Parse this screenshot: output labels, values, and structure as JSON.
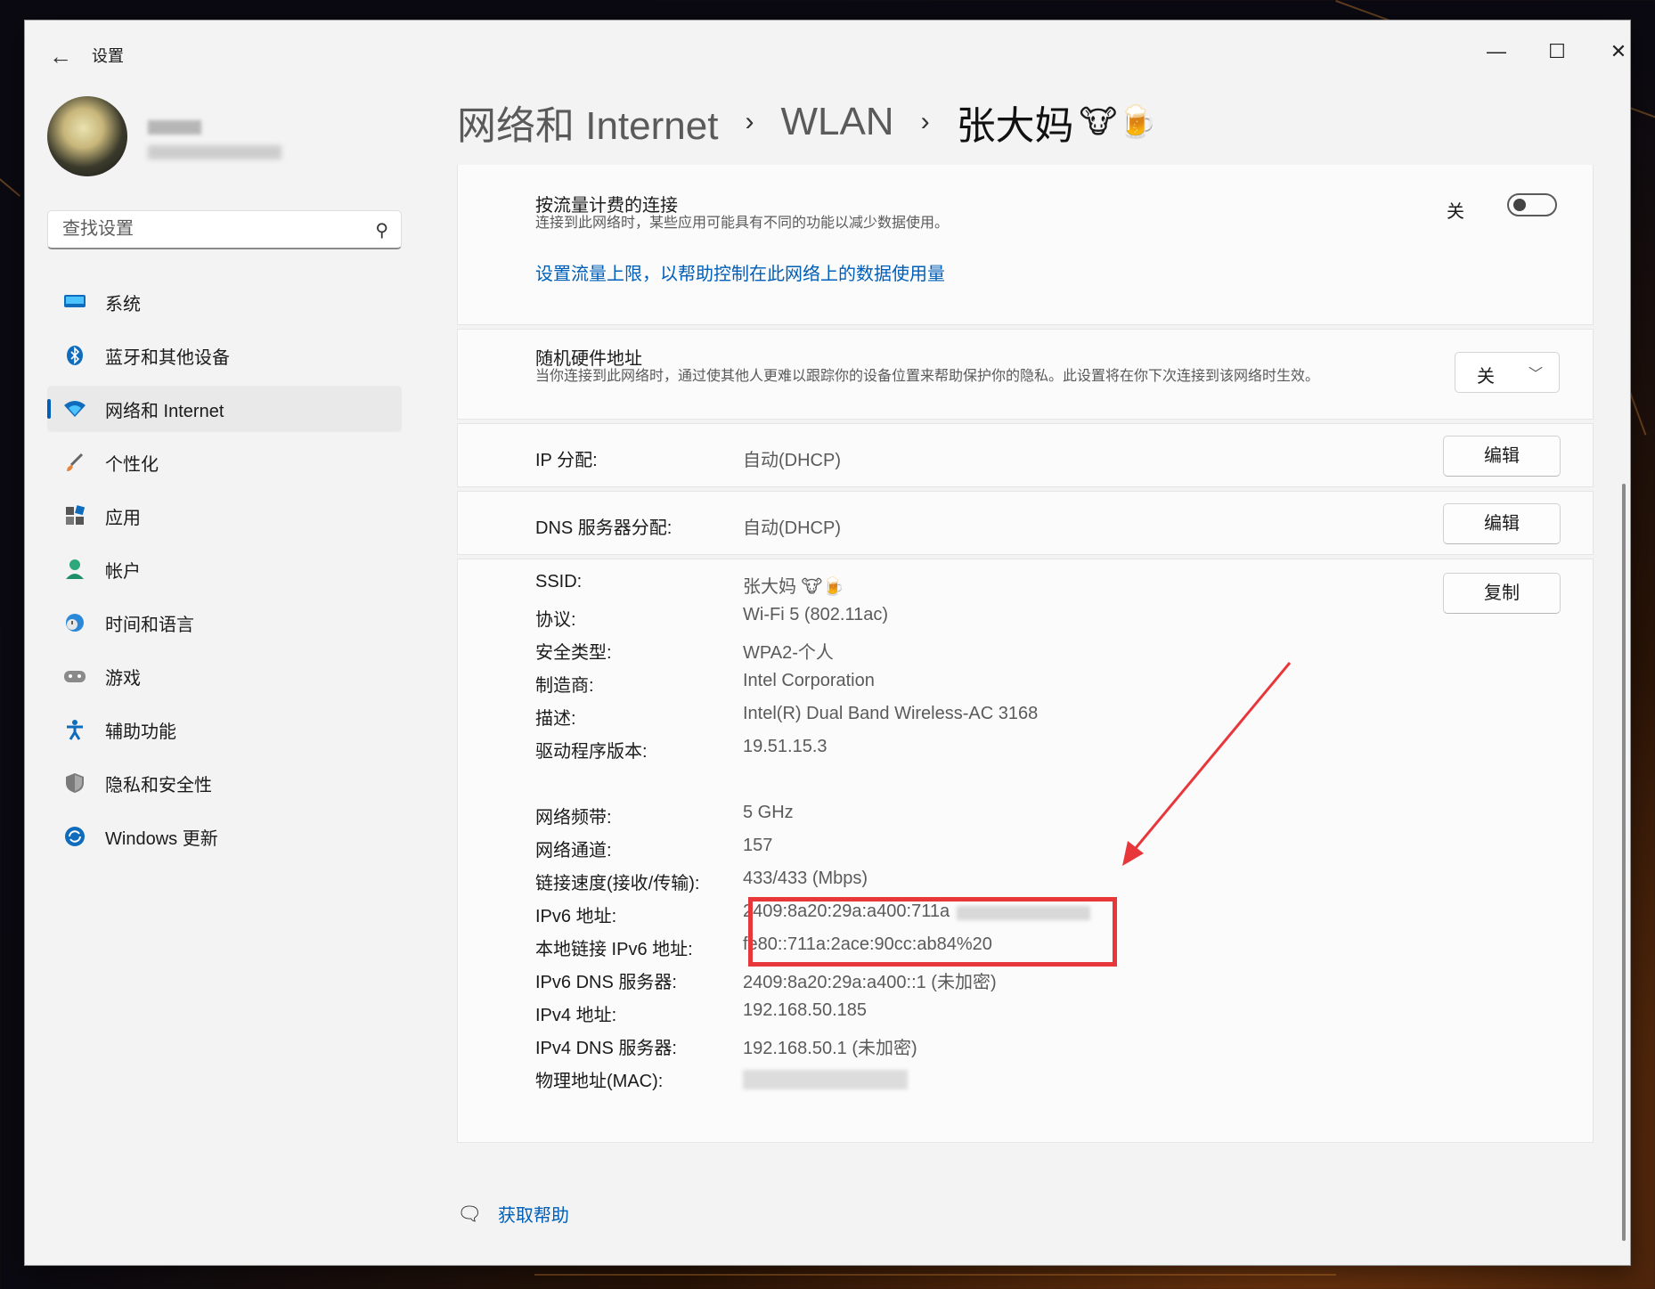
{
  "window": {
    "app_title": "设置",
    "controls": {
      "minimize": "—",
      "maximize": "☐",
      "close": "✕"
    }
  },
  "search": {
    "placeholder": "查找设置"
  },
  "sidebar": {
    "items": [
      {
        "label": "系统",
        "icon": "system-icon"
      },
      {
        "label": "蓝牙和其他设备",
        "icon": "bluetooth-icon"
      },
      {
        "label": "网络和 Internet",
        "icon": "wifi-icon",
        "active": true
      },
      {
        "label": "个性化",
        "icon": "brush-icon"
      },
      {
        "label": "应用",
        "icon": "apps-icon"
      },
      {
        "label": "帐户",
        "icon": "account-icon"
      },
      {
        "label": "时间和语言",
        "icon": "globe-clock-icon"
      },
      {
        "label": "游戏",
        "icon": "gamepad-icon"
      },
      {
        "label": "辅助功能",
        "icon": "accessibility-icon"
      },
      {
        "label": "隐私和安全性",
        "icon": "shield-icon"
      },
      {
        "label": "Windows 更新",
        "icon": "update-icon"
      }
    ]
  },
  "breadcrumb": {
    "part1": "网络和 Internet",
    "part2": "WLAN",
    "part3": "张大妈",
    "emoji": "🐮🍺",
    "separator": "›"
  },
  "metered": {
    "title": "按流量计费的连接",
    "desc": "连接到此网络时，某些应用可能具有不同的功能以减少数据使用。",
    "toggle_label": "关",
    "link": "设置流量上限，以帮助控制在此网络上的数据使用量"
  },
  "random_mac": {
    "title": "随机硬件地址",
    "desc": "当你连接到此网络时，通过使其他人更难以跟踪你的设备位置来帮助保护你的隐私。此设置将在你下次连接到该网络时生效。",
    "value": "关"
  },
  "ip_assign": {
    "label": "IP 分配:",
    "value": "自动(DHCP)",
    "button": "编辑"
  },
  "dns_assign": {
    "label": "DNS 服务器分配:",
    "value": "自动(DHCP)",
    "button": "编辑"
  },
  "properties": {
    "copy_button": "复制",
    "rows": [
      {
        "label": "SSID:",
        "value": "张大妈 🐮🍺"
      },
      {
        "label": "协议:",
        "value": "Wi-Fi 5 (802.11ac)"
      },
      {
        "label": "安全类型:",
        "value": "WPA2-个人"
      },
      {
        "label": "制造商:",
        "value": "Intel Corporation"
      },
      {
        "label": "描述:",
        "value": "Intel(R) Dual Band Wireless-AC 3168"
      },
      {
        "label": "驱动程序版本:",
        "value": "19.51.15.3"
      },
      {
        "label": "网络频带:",
        "value": "5 GHz"
      },
      {
        "label": "网络通道:",
        "value": "157"
      },
      {
        "label": "链接速度(接收/传输):",
        "value": "433/433 (Mbps)"
      },
      {
        "label": "IPv6 地址:",
        "value": "2409:8a20:29a:a400:711a"
      },
      {
        "label": "本地链接 IPv6 地址:",
        "value": "fe80::711a:2ace:90cc:ab84%20"
      },
      {
        "label": "IPv6 DNS 服务器:",
        "value": "2409:8a20:29a:a400::1 (未加密)"
      },
      {
        "label": "IPv4 地址:",
        "value": "192.168.50.185"
      },
      {
        "label": "IPv4 DNS 服务器:",
        "value": "192.168.50.1 (未加密)"
      },
      {
        "label": "物理地址(MAC):",
        "value": ""
      }
    ]
  },
  "help": {
    "label": "获取帮助"
  },
  "colors": {
    "accent": "#005fb8",
    "highlight_box": "#e8373b"
  }
}
